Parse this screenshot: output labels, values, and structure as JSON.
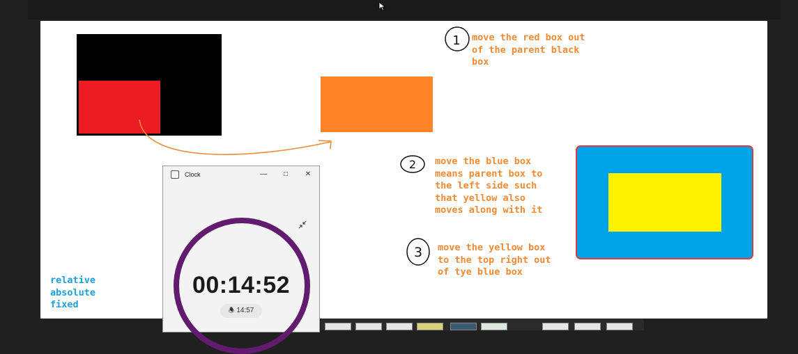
{
  "colors": {
    "canvas": "#ffffff",
    "black_box": "#000000",
    "red_box": "#ed1c24",
    "orange_box": "#ff8427",
    "blue_box": "#00a2e8",
    "blue_box_border": "#e03a3e",
    "yellow_box": "#fff200",
    "note_text": "#f08a35",
    "concept_text": "#1ca1d8",
    "clock_ring": "#621b6e"
  },
  "canvas": {
    "note1": {
      "number": "1",
      "text": "move the red box out\nof the parent black\nbox"
    },
    "note2": {
      "number": "2",
      "text": "move the blue box\nmeans parent box to\nthe left side such\nthat yellow also\nmoves along with it"
    },
    "note3": {
      "number": "3",
      "text": "move the yellow box\nto the top right out\nof tye blue box"
    },
    "concepts": [
      "relative",
      "absolute",
      "fixed"
    ]
  },
  "clock_window": {
    "title": "Clock",
    "app_icon": "clock-app-icon",
    "minimize_icon": "minimize-icon",
    "maximize_icon": "maximize-icon",
    "close_icon": "close-icon",
    "compact_icon": "collapse-arrows-icon",
    "time": "00:14:52",
    "alarm_time": "14:57",
    "alarm_icon": "bell-icon"
  }
}
